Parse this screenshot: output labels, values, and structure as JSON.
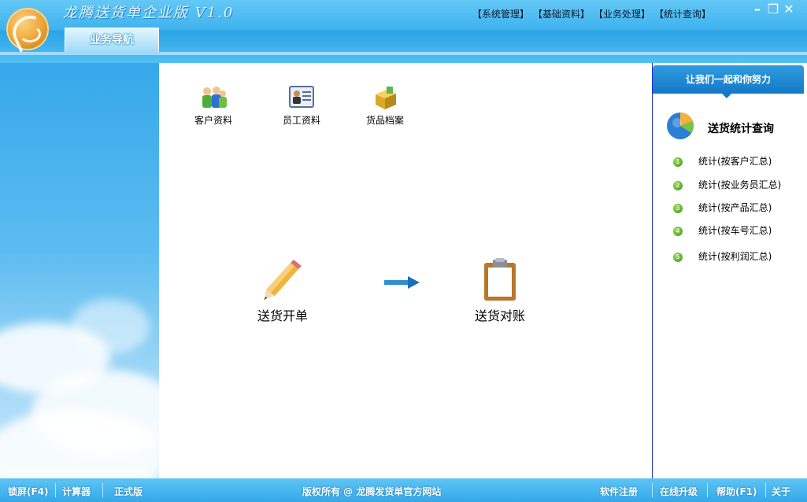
{
  "app": {
    "title": "龙腾送货单企业版 V1.0"
  },
  "topmenu": [
    "【系统管理】",
    "【基础资料】",
    "【业务处理】",
    "【统计查询】"
  ],
  "window_controls": [
    "minimize-icon",
    "restore-icon",
    "close-icon"
  ],
  "tab": {
    "label": "业务导航"
  },
  "main": {
    "icons": [
      {
        "label": "客户资料",
        "icon": "customers-icon"
      },
      {
        "label": "员工资料",
        "icon": "employee-card-icon"
      },
      {
        "label": "货品档案",
        "icon": "goods-icon"
      }
    ],
    "flow": [
      {
        "label": "送货开单",
        "icon": "pencil-icon"
      },
      {
        "label": "送货对账",
        "icon": "clipboard-icon"
      }
    ]
  },
  "right": {
    "header": "让我们一起和你努力",
    "title": "送货统计查询",
    "stats": [
      {
        "num": "1",
        "label": "统计(按客户汇总)"
      },
      {
        "num": "2",
        "label": "统计(按业务员汇总)"
      },
      {
        "num": "3",
        "label": "统计(按产品汇总)"
      },
      {
        "num": "4",
        "label": "统计(按车号汇总)"
      },
      {
        "num": "5",
        "label": "统计(按利润汇总)"
      }
    ]
  },
  "status": {
    "lock": "锁屏(F4)",
    "calc": "计算器",
    "edition": "正式版",
    "copyright": "版权所有 @ 龙腾发货单官方网站",
    "register": "软件注册",
    "upgrade": "在线升级",
    "help": "帮助(F1)",
    "about": "关于"
  },
  "colors": {
    "accent": "#3fb2ee",
    "panel_header": "#1479c7",
    "bullet": "#4fa024"
  }
}
